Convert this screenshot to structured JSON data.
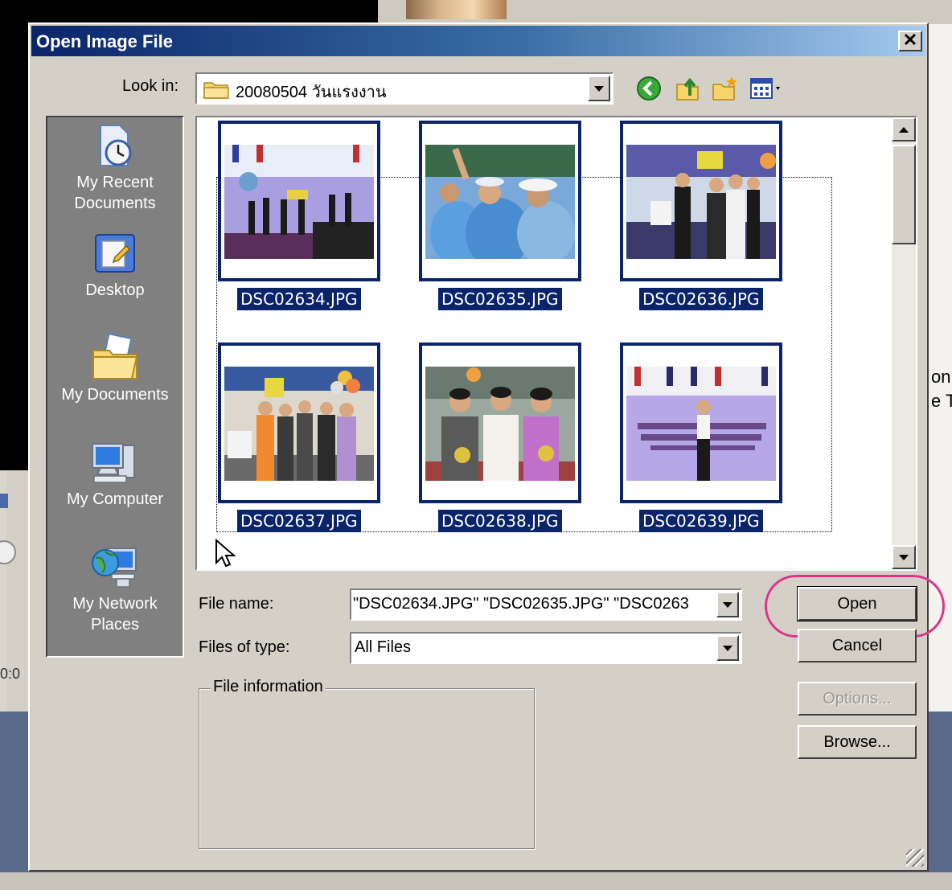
{
  "background": {
    "right_text": "on\ne T",
    "left_label": "0:0"
  },
  "dialog": {
    "title": "Open Image File",
    "close_glyph": "✕"
  },
  "look_in": {
    "label": "Look in:",
    "value": "20080504 วันแรงงาน"
  },
  "toolbar": {
    "icons": [
      "back-icon",
      "up-folder-icon",
      "new-folder-icon",
      "views-menu-icon"
    ]
  },
  "places": [
    {
      "label": "My Recent\nDocuments",
      "icon": "recent-documents-icon"
    },
    {
      "label": "Desktop",
      "icon": "desktop-icon"
    },
    {
      "label": "My Documents",
      "icon": "my-documents-icon"
    },
    {
      "label": "My Computer",
      "icon": "my-computer-icon"
    },
    {
      "label": "My Network\nPlaces",
      "icon": "network-places-icon"
    }
  ],
  "files": [
    {
      "name": "DSC02634.JPG",
      "selected": true
    },
    {
      "name": "DSC02635.JPG",
      "selected": true
    },
    {
      "name": "DSC02636.JPG",
      "selected": true
    },
    {
      "name": "DSC02637.JPG",
      "selected": true
    },
    {
      "name": "DSC02638.JPG",
      "selected": true
    },
    {
      "name": "DSC02639.JPG",
      "selected": true
    }
  ],
  "file_name": {
    "label": "File name:",
    "value": "\"DSC02634.JPG\" \"DSC02635.JPG\" \"DSC0263"
  },
  "file_type": {
    "label": "Files of type:",
    "value": "All Files"
  },
  "file_information": {
    "label": "File information"
  },
  "buttons": {
    "open": "Open",
    "cancel": "Cancel",
    "options": "Options...",
    "browse": "Browse..."
  },
  "colors": {
    "selection": "#0a246a",
    "highlight_ring": "#e0338a",
    "dialog_face": "#d4d0c8"
  }
}
